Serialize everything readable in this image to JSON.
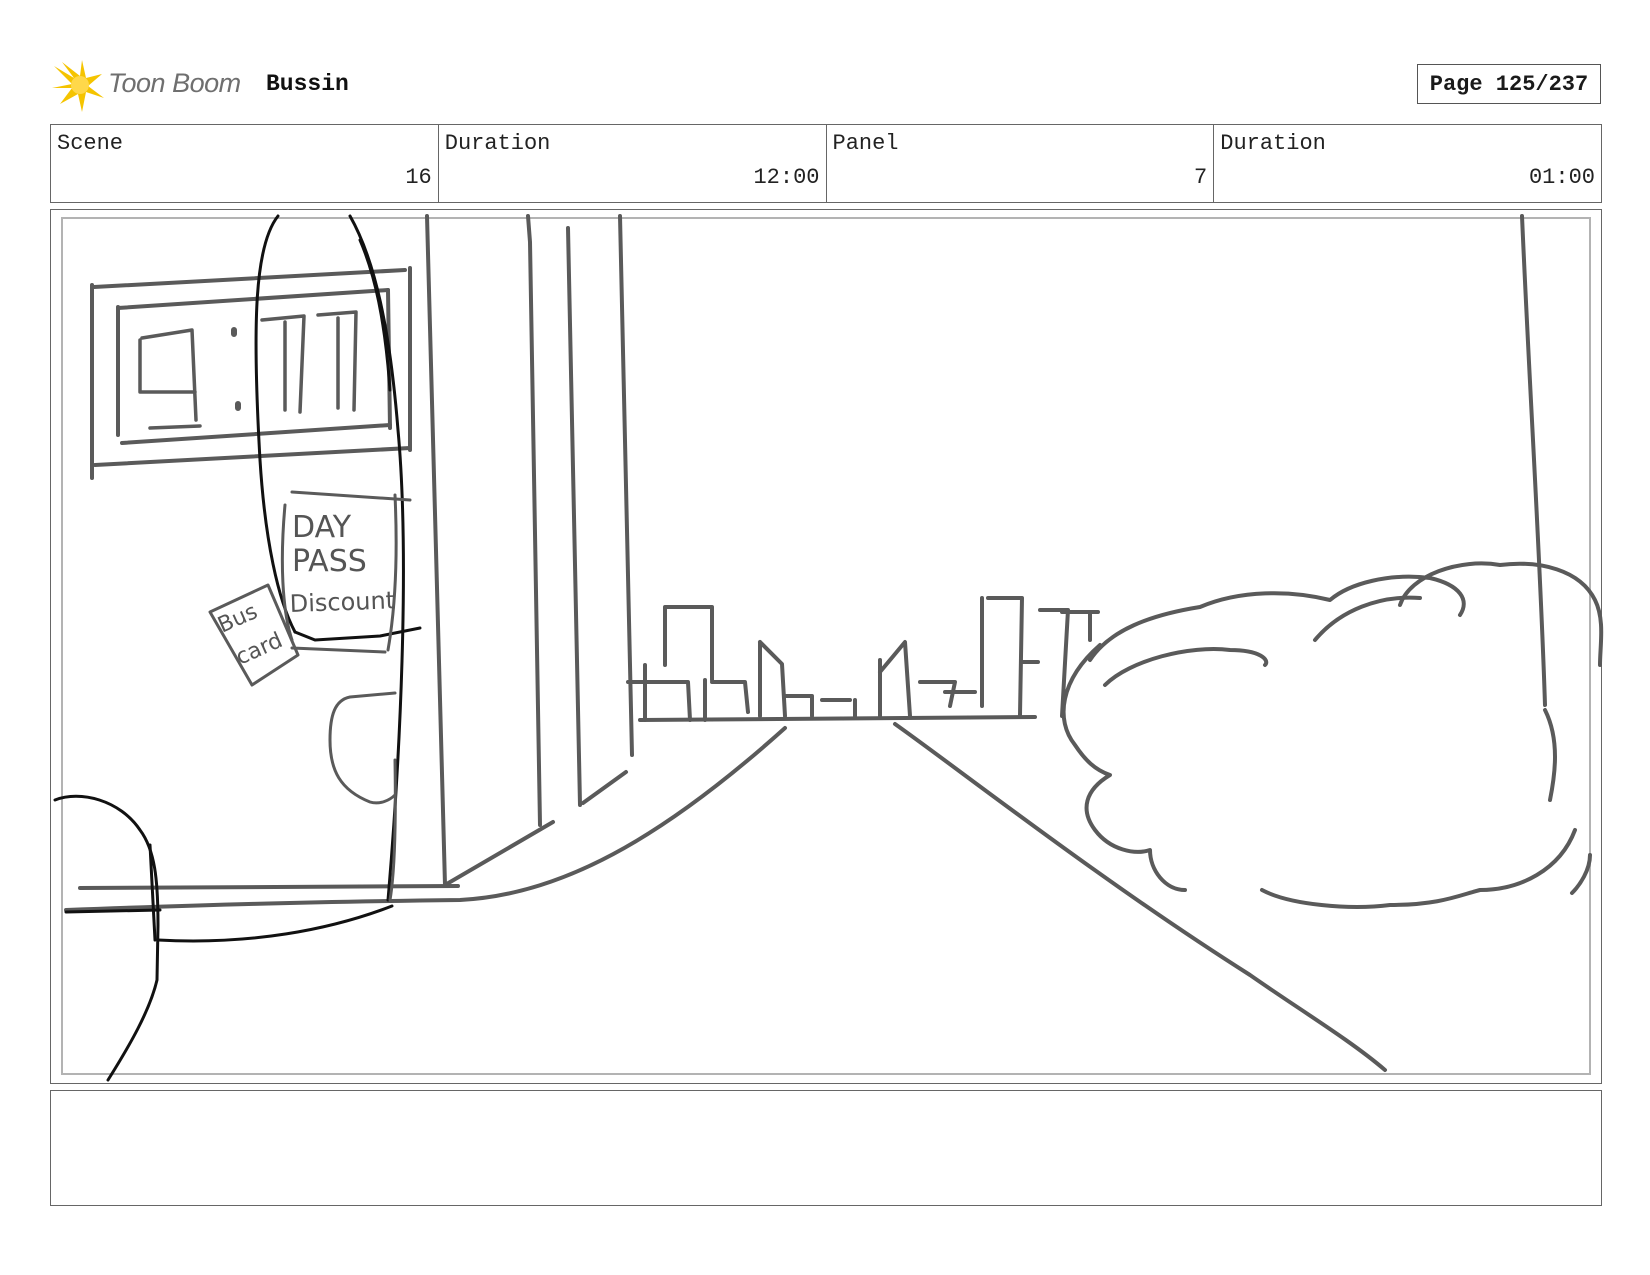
{
  "header": {
    "logo_text": "Toon Boom",
    "project_title": "Bussin",
    "page_label": "Page 125/237"
  },
  "info": {
    "scene_label": "Scene",
    "scene_value": "16",
    "scene_duration_label": "Duration",
    "scene_duration_value": "12:00",
    "panel_label": "Panel",
    "panel_value": "7",
    "panel_duration_label": "Duration",
    "panel_duration_value": "01:00"
  },
  "sketch": {
    "clock_reading": "9:11",
    "sign_lines": [
      "DAY",
      "PASS",
      "Discount"
    ],
    "card_lines": [
      "Bus",
      "card"
    ]
  },
  "notes": {
    "text": ""
  },
  "colors": {
    "logo_star": "#f5c400",
    "sketch_stroke": "#5a5a5a",
    "sketch_dark": "#111111"
  }
}
